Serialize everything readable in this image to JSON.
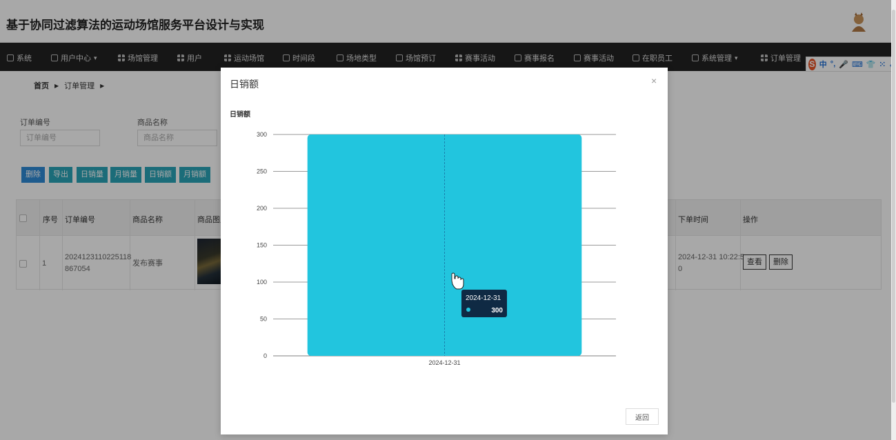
{
  "app": {
    "title": "基于协同过滤算法的运动场馆服务平台设计与实现"
  },
  "nav": {
    "items": [
      {
        "label": "系统",
        "icon": "home-icon"
      },
      {
        "label": "用户中心",
        "icon": "calendar-icon",
        "dropdown": true
      },
      {
        "label": "场馆管理",
        "icon": "grid-icon"
      },
      {
        "label": "用户",
        "icon": "grid-icon"
      },
      {
        "label": "运动场馆",
        "icon": "grid-icon"
      },
      {
        "label": "时间段",
        "icon": "tag-icon"
      },
      {
        "label": "场地类型",
        "icon": "file-icon"
      },
      {
        "label": "场馆预订",
        "icon": "user-icon"
      },
      {
        "label": "赛事活动",
        "icon": "grid-icon"
      },
      {
        "label": "赛事报名",
        "icon": "chat-icon"
      },
      {
        "label": "赛事活动",
        "icon": "list-icon"
      },
      {
        "label": "在职员工",
        "icon": "check-icon"
      },
      {
        "label": "系统管理",
        "icon": "table-icon",
        "dropdown": true
      },
      {
        "label": "订单管理",
        "icon": "grid-icon"
      }
    ]
  },
  "ime": {
    "items": [
      "中",
      "°,",
      "🎤",
      "⌨",
      "👕",
      "⁙",
      "➶"
    ]
  },
  "breadcrumb": {
    "home": "首页",
    "current": "订单管理"
  },
  "search": {
    "order_no_label": "订单编号",
    "order_no_placeholder": "订单编号",
    "product_label": "商品名称",
    "product_placeholder": "商品名称"
  },
  "actions": {
    "delete": "删除",
    "export": "导出",
    "daily_sales_volume": "日销量",
    "monthly_sales_volume": "月销量",
    "daily_sales_amount": "日销额",
    "monthly_sales_amount": "月销额"
  },
  "table": {
    "headers": {
      "index": "序号",
      "order_no": "订单编号",
      "product": "商品名称",
      "image": "商品图片",
      "order_time": "下单时间",
      "operation": "操作"
    },
    "rows": [
      {
        "index": "1",
        "order_no_line1": "2024123110225118",
        "order_no_line2": "867054",
        "product": "发布赛事",
        "order_time_line1": "2024-12-31 10:22:5",
        "order_time_line2": "0",
        "view": "查看",
        "delete": "删除"
      }
    ]
  },
  "modal": {
    "title": "日销额",
    "close": "×",
    "return_label": "返回"
  },
  "colors": {
    "bar": "#22c5de",
    "primary_button": "#2e8bd6",
    "teal_button": "#2aa5b8",
    "nav_bg": "#222222",
    "tooltip_bg": "#0f2a44"
  },
  "chart_data": {
    "type": "bar",
    "title": "日销额",
    "categories": [
      "2024-12-31"
    ],
    "values": [
      300
    ],
    "ylim": [
      0,
      300
    ],
    "yticks": [
      0,
      50,
      100,
      150,
      200,
      250,
      300
    ],
    "grid": true,
    "tooltip": {
      "label": "2024-12-31",
      "value": "300"
    }
  }
}
